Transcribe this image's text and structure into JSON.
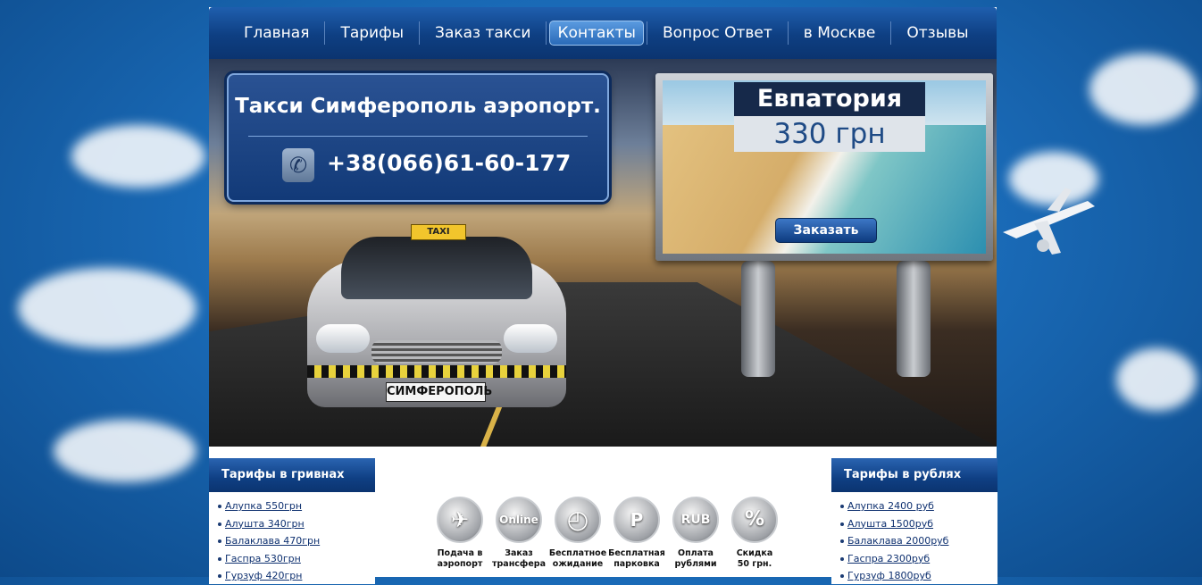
{
  "nav": {
    "items": [
      {
        "label": "Главная"
      },
      {
        "label": "Тарифы"
      },
      {
        "label": "Заказ такси"
      },
      {
        "label": "Контакты",
        "active": true
      },
      {
        "label": "Вопрос Ответ"
      },
      {
        "label": "в Москве"
      },
      {
        "label": "Отзывы"
      }
    ]
  },
  "hero": {
    "title": "Такси Симферополь аэропорт.",
    "phone": "+38(066)61-60-177",
    "taxi_sign": "TAXI",
    "plate": "СИМФЕРОПОЛЬ"
  },
  "billboard": {
    "city": "Евпатория",
    "price": "330 грн",
    "order_button": "Заказать"
  },
  "sidebar_left": {
    "title": "Тарифы в гривнах",
    "items": [
      "Алупка 550грн",
      "Алушта 340грн",
      "Балаклава 470грн",
      "Гаспра 530грн",
      "Гурзуф 420грн"
    ]
  },
  "sidebar_right": {
    "title": "Тарифы в рублях",
    "items": [
      "Алупка 2400 руб",
      "Алушта 1500руб",
      "Балаклава 2000руб",
      "Гаспра 2300руб",
      "Гурзуф 1800руб"
    ]
  },
  "features": [
    {
      "icon": "airplane-icon",
      "glyph": "✈",
      "line1": "Подача в",
      "line2": "аэропорт"
    },
    {
      "icon": "online-icon",
      "glyph": "Online",
      "line1": "Заказ",
      "line2": "трансфера"
    },
    {
      "icon": "clock-icon",
      "glyph": "◴",
      "line1": "Бесплатное",
      "line2": "ожидание"
    },
    {
      "icon": "parking-icon",
      "glyph": "P",
      "line1": "Бесплатная",
      "line2": "парковка"
    },
    {
      "icon": "rub-icon",
      "glyph": "RUB",
      "line1": "Оплата",
      "line2": "рублями"
    },
    {
      "icon": "percent-icon",
      "glyph": "%",
      "line1": "Скидка",
      "line2": "50 грн."
    }
  ]
}
